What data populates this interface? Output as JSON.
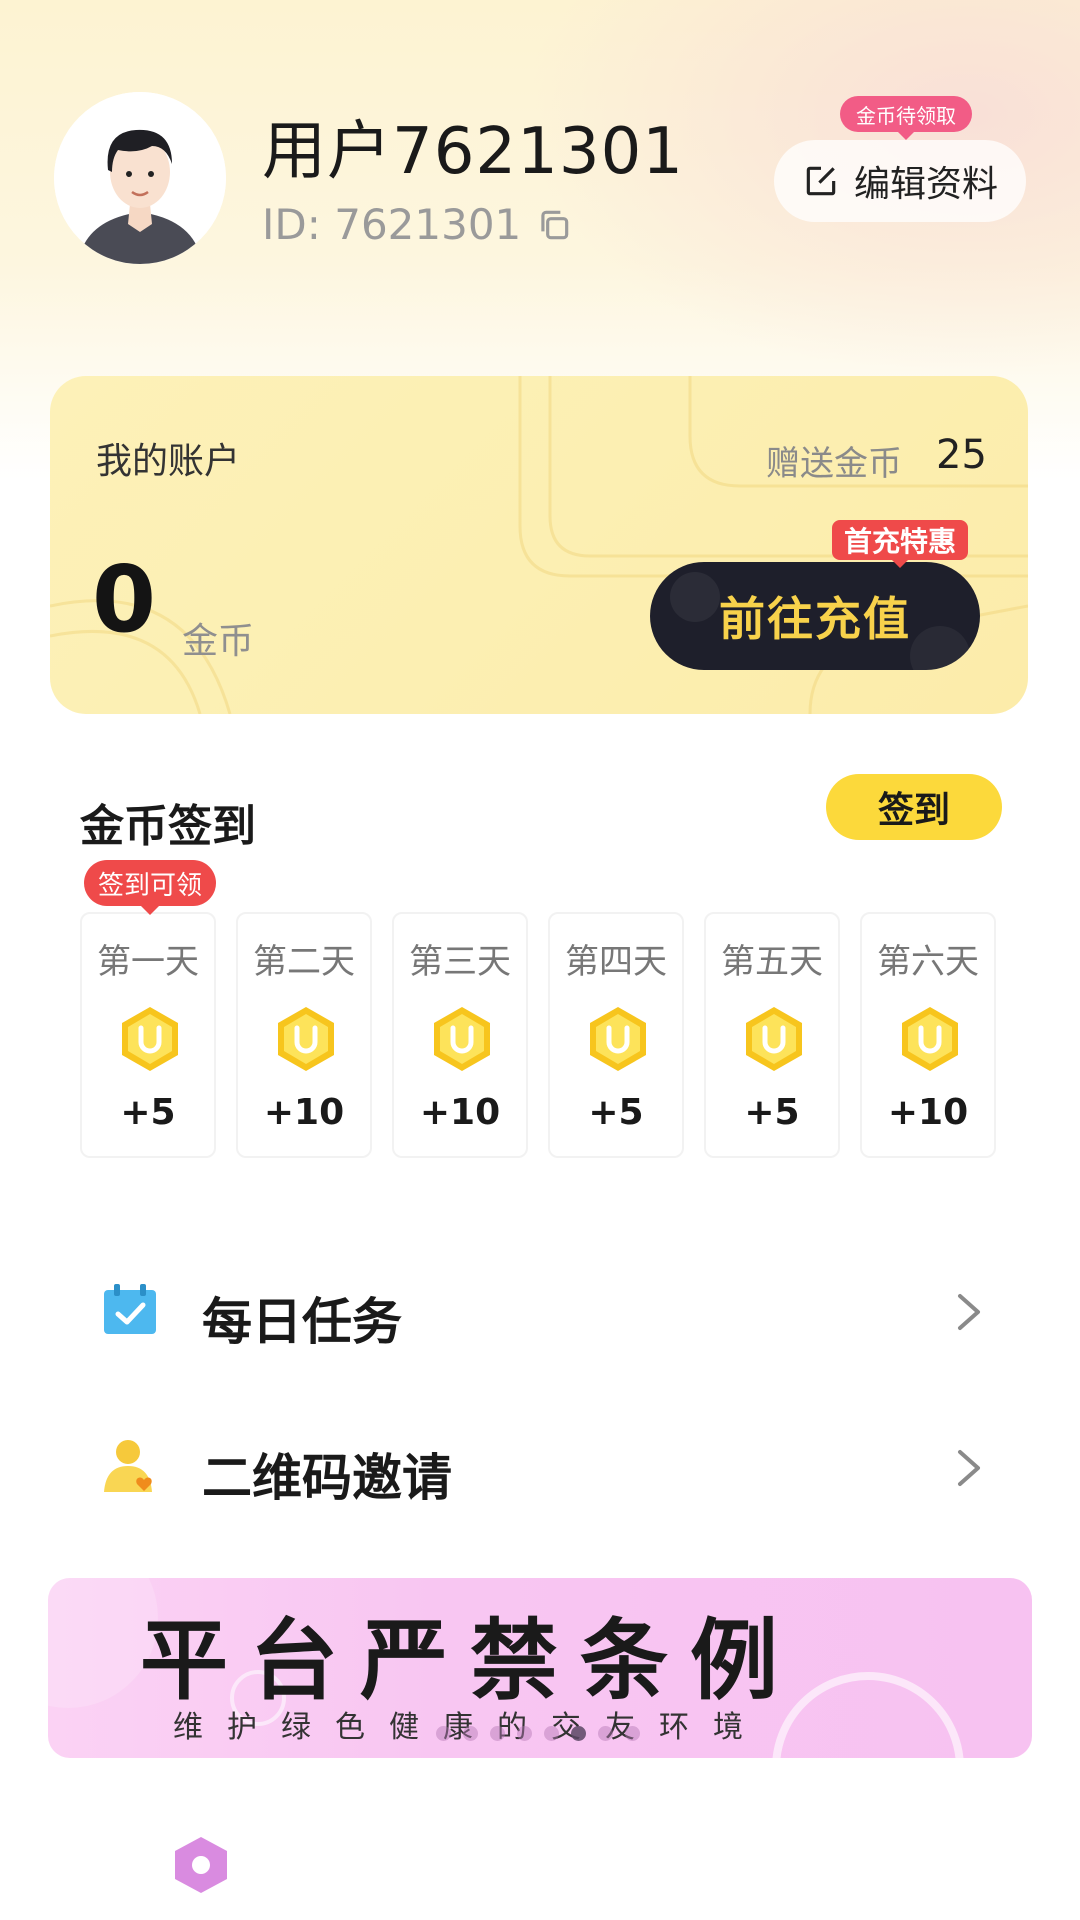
{
  "profile": {
    "username": "用户7621301",
    "id_text": "ID: 7621301",
    "edit_label": "编辑资料",
    "coin_pending_label": "金币待领取"
  },
  "account": {
    "title": "我的账户",
    "gift_label": "赠送金币",
    "gift_value": "25",
    "balance": "0",
    "balance_unit": "金币",
    "recharge_label": "前往充值",
    "first_recharge_badge": "首充特惠"
  },
  "signin": {
    "title": "金币签到",
    "button_label": "签到",
    "claim_badge": "签到可领",
    "days": [
      {
        "label": "第一天",
        "reward": "+5"
      },
      {
        "label": "第二天",
        "reward": "+10"
      },
      {
        "label": "第三天",
        "reward": "+10"
      },
      {
        "label": "第四天",
        "reward": "+5"
      },
      {
        "label": "第五天",
        "reward": "+5"
      },
      {
        "label": "第六天",
        "reward": "+10"
      }
    ]
  },
  "menu": {
    "items": [
      {
        "label": "每日任务",
        "icon": "calendar-check-icon"
      },
      {
        "label": "二维码邀请",
        "icon": "user-heart-icon"
      }
    ]
  },
  "banner": {
    "title": "平台严禁条例",
    "subtitle": "维护绿色健康的交友环境",
    "active_index": 5,
    "total": 8
  },
  "colors": {
    "accent_yellow": "#fcd93b",
    "recharge_text": "#f8d24b",
    "badge_red": "#ef4a4a",
    "badge_pink": "#f25c86"
  }
}
